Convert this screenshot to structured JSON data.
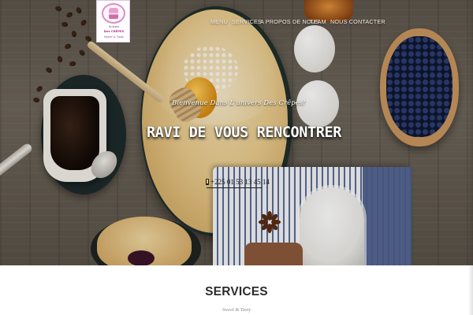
{
  "logo": {
    "line1": "Univers",
    "line2": "Des CRÊPES",
    "line3": "Sweet & Tasty"
  },
  "nav": {
    "items": [
      {
        "label": "MENU"
      },
      {
        "label": "SERVICES"
      },
      {
        "label": "A PROPOS DE NOUS"
      },
      {
        "label": "TEAM"
      },
      {
        "label": "NOUS CONTACTER"
      }
    ]
  },
  "hero": {
    "tagline": "Bienvenue Dans L'univers Des Crêpes!",
    "headline": "RAVI DE VOUS RENCONTRER",
    "phone": "+225 01 53 13 45 14"
  },
  "services": {
    "title": "SERVICES",
    "subtitle": "Sweet & Tasty"
  },
  "colors": {
    "hero_text": "#ffffff",
    "nav_text": "#f0ece4",
    "section_title": "#2c2c2c",
    "section_subtitle": "#8a8a8a"
  },
  "icons": {
    "phone": "phone-icon",
    "logo": "cake-icon"
  }
}
